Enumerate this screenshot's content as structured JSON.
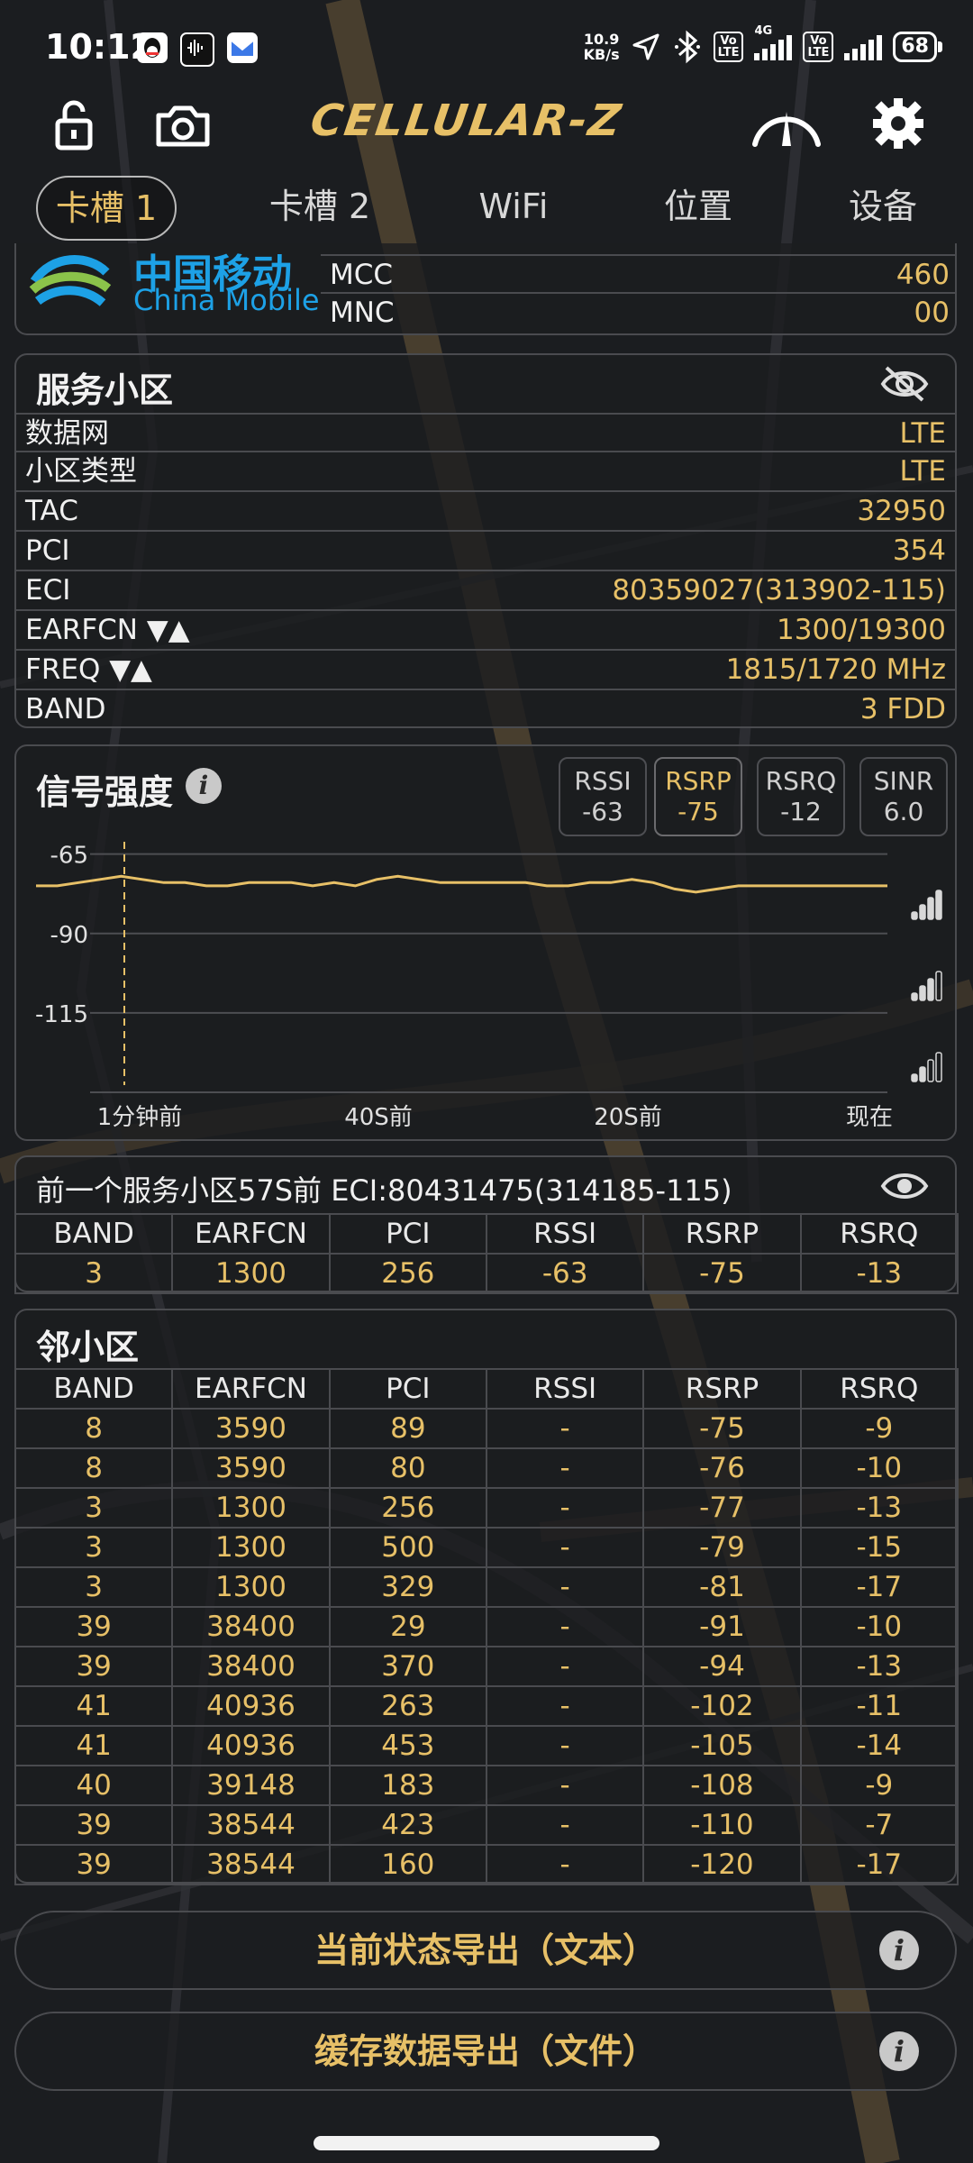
{
  "status_bar": {
    "time": "10:12",
    "net_speed_value": "10.9",
    "net_speed_unit": "KB/s",
    "volte": "Vo\nLTE",
    "network_4g": "4G",
    "battery": "68"
  },
  "app": {
    "logo_text": "CELLULAR-Z"
  },
  "tabs": [
    "卡槽 1",
    "卡槽 2",
    "WiFi",
    "位置",
    "设备"
  ],
  "operator": {
    "name_cn": "中国移动",
    "name_en": "China Mobile",
    "rows": [
      {
        "key": "MCC",
        "value": "460"
      },
      {
        "key": "MNC",
        "value": "00"
      }
    ]
  },
  "serving_cell": {
    "title": "服务小区",
    "rows": [
      {
        "key": "数据网",
        "value": "LTE"
      },
      {
        "key": "小区类型",
        "value": "LTE"
      },
      {
        "key": "TAC",
        "value": "32950"
      },
      {
        "key": "PCI",
        "value": "354"
      },
      {
        "key": "ECI",
        "value": "80359027(313902-115)"
      },
      {
        "key": "EARFCN ▼▲",
        "value": "1300/19300"
      },
      {
        "key": "FREQ ▼▲",
        "value": "1815/1720 MHz"
      },
      {
        "key": "BAND",
        "value": "3 FDD"
      }
    ]
  },
  "signal": {
    "title": "信号强度",
    "metrics": [
      {
        "label": "RSSI",
        "value": "-63"
      },
      {
        "label": "RSRP",
        "value": "-75"
      },
      {
        "label": "RSRQ",
        "value": "-12"
      },
      {
        "label": "SINR",
        "value": "6.0"
      }
    ],
    "active_metric": "RSRP"
  },
  "chart_data": {
    "type": "line",
    "series": [
      {
        "values": [
          -75,
          -75,
          -74,
          -73,
          -72,
          -73,
          -74,
          -74,
          -75,
          -75,
          -74,
          -74,
          -74,
          -75,
          -74,
          -75,
          -73,
          -72,
          -73,
          -74,
          -74,
          -74,
          -74,
          -74,
          -75,
          -75,
          -74,
          -74,
          -73,
          -74,
          -76,
          -77,
          -76,
          -75,
          -75,
          -75,
          -75,
          -75,
          -75,
          -75,
          -75
        ]
      }
    ],
    "x_tick_labels": [
      "1分钟前",
      "40S前",
      "20S前",
      "现在"
    ],
    "y_tick_labels": [
      "-65",
      "-90",
      "-115"
    ],
    "yticks": [
      -65,
      -90,
      -115
    ],
    "ylim": [
      -140,
      -60
    ],
    "grid": true
  },
  "prev_cell": {
    "title": "前一个服务小区57S前 ECI:80431475(314185-115)",
    "headers": [
      "BAND",
      "EARFCN",
      "PCI",
      "RSSI",
      "RSRP",
      "RSRQ"
    ],
    "rows": [
      [
        "3",
        "1300",
        "256",
        "-63",
        "-75",
        "-13"
      ]
    ]
  },
  "neighbors": {
    "title": "邻小区",
    "headers": [
      "BAND",
      "EARFCN",
      "PCI",
      "RSSI",
      "RSRP",
      "RSRQ"
    ],
    "rows": [
      [
        "8",
        "3590",
        "89",
        "-",
        "-75",
        "-9"
      ],
      [
        "8",
        "3590",
        "80",
        "-",
        "-76",
        "-10"
      ],
      [
        "3",
        "1300",
        "256",
        "-",
        "-77",
        "-13"
      ],
      [
        "3",
        "1300",
        "500",
        "-",
        "-79",
        "-15"
      ],
      [
        "3",
        "1300",
        "329",
        "-",
        "-81",
        "-17"
      ],
      [
        "39",
        "38400",
        "29",
        "-",
        "-91",
        "-10"
      ],
      [
        "39",
        "38400",
        "370",
        "-",
        "-94",
        "-13"
      ],
      [
        "41",
        "40936",
        "263",
        "-",
        "-102",
        "-11"
      ],
      [
        "41",
        "40936",
        "453",
        "-",
        "-105",
        "-14"
      ],
      [
        "40",
        "39148",
        "183",
        "-",
        "-108",
        "-9"
      ],
      [
        "39",
        "38544",
        "423",
        "-",
        "-110",
        "-7"
      ],
      [
        "39",
        "38544",
        "160",
        "-",
        "-120",
        "-17"
      ]
    ]
  },
  "buttons": {
    "export_text": "当前状态导出（文本）",
    "export_file": "缓存数据导出（文件）",
    "info_glyph": "i"
  },
  "colors": {
    "accent": "#e7c067",
    "background": "#1b1d20",
    "border": "#4a4b4f"
  }
}
